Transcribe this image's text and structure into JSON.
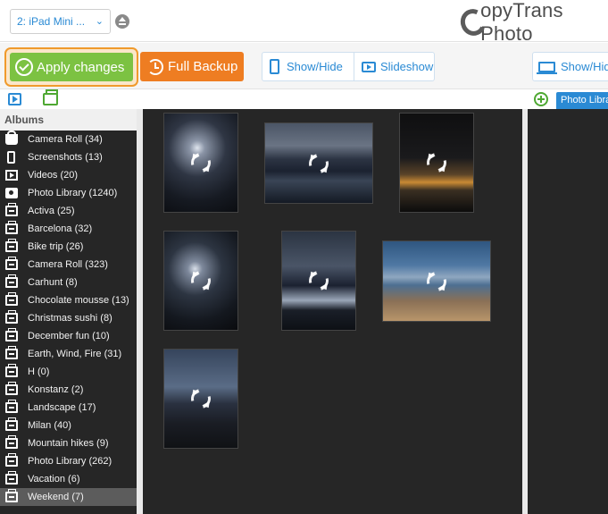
{
  "header": {
    "device_label": "2: iPad Mini ...",
    "logo_text": "opyTrans Photo"
  },
  "toolbar": {
    "apply_label": "Apply changes",
    "backup_label": "Full Backup",
    "device_show_hide_label": "Show/Hide",
    "slideshow_label": "Slideshow",
    "pc_show_hide_label": "Show/Hid"
  },
  "pc_tab_label": "Photo Library",
  "sidebar": {
    "header": "Albums",
    "albums": [
      {
        "label": "Camera Roll (34)",
        "icon": "basket-icon"
      },
      {
        "label": "Screenshots (13)",
        "icon": "phone-icon"
      },
      {
        "label": "Videos (20)",
        "icon": "video-icon"
      },
      {
        "label": "Photo Library (1240)",
        "icon": "camera-icon"
      },
      {
        "label": "Activa (25)",
        "icon": "album-icon"
      },
      {
        "label": "Barcelona (32)",
        "icon": "album-icon"
      },
      {
        "label": "Bike trip (26)",
        "icon": "album-icon"
      },
      {
        "label": "Camera Roll (323)",
        "icon": "album-icon"
      },
      {
        "label": "Carhunt (8)",
        "icon": "album-icon"
      },
      {
        "label": "Chocolate mousse (13)",
        "icon": "album-icon"
      },
      {
        "label": "Christmas sushi (8)",
        "icon": "album-icon"
      },
      {
        "label": "December fun (10)",
        "icon": "album-icon"
      },
      {
        "label": "Earth, Wind, Fire (31)",
        "icon": "album-icon"
      },
      {
        "label": "H (0)",
        "icon": "album-icon"
      },
      {
        "label": "Konstanz (2)",
        "icon": "album-icon"
      },
      {
        "label": "Landscape (17)",
        "icon": "album-icon"
      },
      {
        "label": "Milan (40)",
        "icon": "album-icon"
      },
      {
        "label": "Mountain hikes (9)",
        "icon": "album-icon"
      },
      {
        "label": "Photo Library (262)",
        "icon": "album-icon"
      },
      {
        "label": "Vacation (6)",
        "icon": "album-icon"
      },
      {
        "label": "Weekend (7)",
        "icon": "album-icon",
        "selected": true
      }
    ]
  },
  "colors": {
    "accent_blue": "#2a8ad4",
    "apply_green": "#7cc242",
    "highlight_orange": "#f09a2c",
    "backup_orange": "#ee7d22",
    "panel_dark": "#262626"
  }
}
